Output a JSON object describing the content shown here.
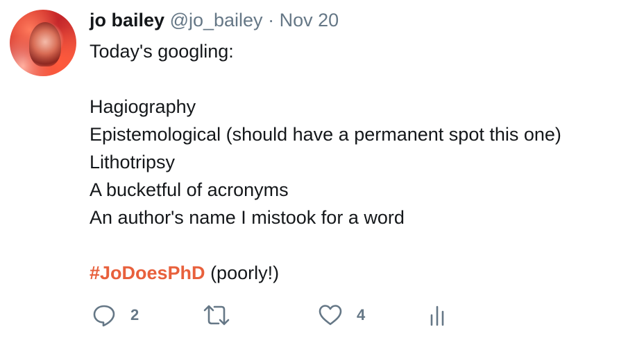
{
  "tweet": {
    "author_name": "jo bailey",
    "handle": "@jo_bailey",
    "separator": "·",
    "date": "Nov 20",
    "lines": [
      "Today's googling:",
      "",
      "Hagiography",
      "Epistemological (should have a permanent spot this one)",
      "Lithotripsy",
      "A bucketful of acronyms",
      "An author's name I mistook for a word",
      ""
    ],
    "hashtag": "#JoDoesPhD",
    "hashtag_suffix": " (poorly!)"
  },
  "actions": {
    "reply_icon": "reply-icon",
    "reply_count": "2",
    "retweet_icon": "retweet-icon",
    "like_icon": "heart-icon",
    "like_count": "4",
    "analytics_icon": "analytics-icon"
  },
  "colors": {
    "text": "#14171a",
    "muted": "#657786",
    "hashtag": "#e8603c",
    "icon": "#657786"
  }
}
